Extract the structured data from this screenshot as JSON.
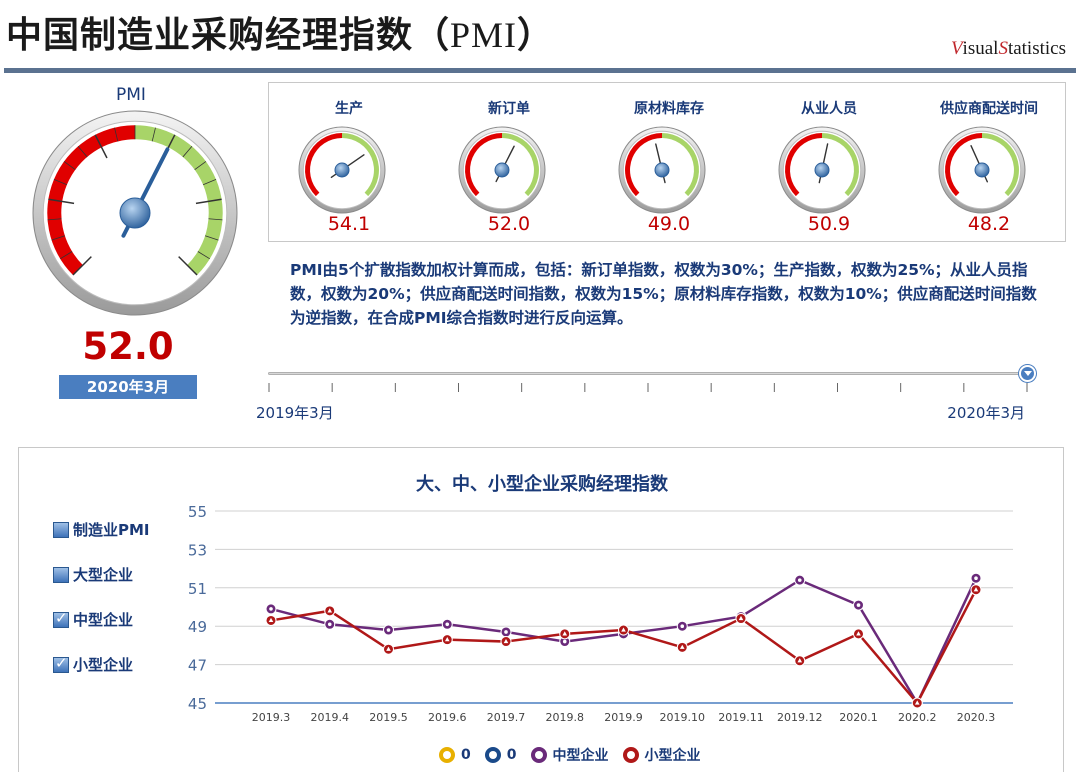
{
  "header": {
    "title": "中国制造业采购经理指数（",
    "title_pmi": "PMI",
    "title_close": "）",
    "brand_v": "V",
    "brand_isual": "isual",
    "brand_s": "S",
    "brand_tatistics": "tatistics"
  },
  "main_gauge": {
    "label": "PMI",
    "value": "52.0",
    "value_num": 52.0,
    "date": "2020年3月"
  },
  "sub_gauges": [
    {
      "name": "生产",
      "value": "54.1",
      "value_num": 54.1
    },
    {
      "name": "新订单",
      "value": "52.0",
      "value_num": 52.0
    },
    {
      "name": "原材料库存",
      "value": "49.0",
      "value_num": 49.0
    },
    {
      "name": "从业人员",
      "value": "50.9",
      "value_num": 50.9
    },
    {
      "name": "供应商配送时间",
      "value": "48.2",
      "value_num": 48.2
    }
  ],
  "gauge_scale": {
    "min": 40,
    "max": 60,
    "red_until": 50
  },
  "description": "PMI由5个扩散指数加权计算而成，包括：新订单指数，权数为30%；生产指数，权数为25%；从业人员指数，权数为20%；供应商配送时间指数，权数为15%；原材料库存指数，权数为10%；供应商配送时间指数为逆指数，在合成PMI综合指数时进行反向运算。",
  "timeline": {
    "start": "2019年3月",
    "end": "2020年3月",
    "position": 1.0
  },
  "legend_left": [
    {
      "label": "制造业PMI",
      "checked": false
    },
    {
      "label": "大型企业",
      "checked": false
    },
    {
      "label": "中型企业",
      "checked": true
    },
    {
      "label": "小型企业",
      "checked": true
    }
  ],
  "bottom_legend": [
    {
      "label": "0",
      "color": "#e8b000"
    },
    {
      "label": "0",
      "color": "#1a4a8a"
    },
    {
      "label": "中型企业",
      "color": "#6a2a7a"
    },
    {
      "label": "小型企业",
      "color": "#b01818"
    }
  ],
  "colors": {
    "red_zone": "#e00000",
    "green_zone": "#a8d468",
    "medium": "#6a2a7a",
    "small": "#b01818",
    "accent": "#4a7ec0"
  },
  "chart_data": {
    "type": "line",
    "title": "大、中、小型企业采购经理指数",
    "categories": [
      "2019.3",
      "2019.4",
      "2019.5",
      "2019.6",
      "2019.7",
      "2019.8",
      "2019.9",
      "2019.10",
      "2019.11",
      "2019.12",
      "2020.1",
      "2020.2",
      "2020.3"
    ],
    "series": [
      {
        "name": "中型企业",
        "values": [
          49.9,
          49.1,
          48.8,
          49.1,
          48.7,
          48.2,
          48.6,
          49.0,
          49.5,
          51.4,
          50.1,
          45.0,
          51.5
        ]
      },
      {
        "name": "小型企业",
        "values": [
          49.3,
          49.8,
          47.8,
          48.3,
          48.2,
          48.6,
          48.8,
          47.9,
          49.4,
          47.2,
          48.6,
          45.0,
          50.9
        ]
      }
    ],
    "yticks": [
      45,
      47,
      49,
      51,
      53,
      55
    ],
    "ylim": [
      45,
      55
    ],
    "grid": true,
    "legend": "bottom"
  }
}
